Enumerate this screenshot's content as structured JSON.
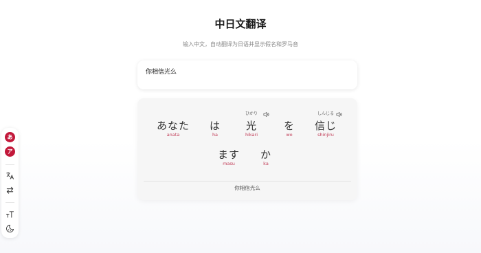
{
  "header": {
    "title": "中日文翻译",
    "subtitle": "输入中文，自动翻译为日语并显示假名和罗马音"
  },
  "input": {
    "value": "你相信光么"
  },
  "result": {
    "row1": [
      {
        "kana": "あなた",
        "furigana": "",
        "romaji": "anata"
      },
      {
        "kana": "は",
        "furigana": "",
        "romaji": "ha"
      },
      {
        "kana": "光",
        "furigana": "ひかり",
        "romaji": "hikari"
      },
      {
        "kana": "を",
        "furigana": "",
        "romaji": "wo"
      },
      {
        "kana": "信じ",
        "furigana": "しんじる",
        "romaji": "shinjiru"
      }
    ],
    "row2": [
      {
        "kana": "ます",
        "furigana": "",
        "romaji": "masu"
      },
      {
        "kana": "か",
        "furigana": "",
        "romaji": "ka"
      }
    ],
    "source_text": "你相信光么"
  },
  "sidebar": {
    "hiragana_badge": "あ",
    "katakana_badge": "ア",
    "icons": [
      "translate-icon",
      "swap-icon",
      "font-size-icon",
      "theme-icon"
    ],
    "accent_color": "#c2183a"
  }
}
